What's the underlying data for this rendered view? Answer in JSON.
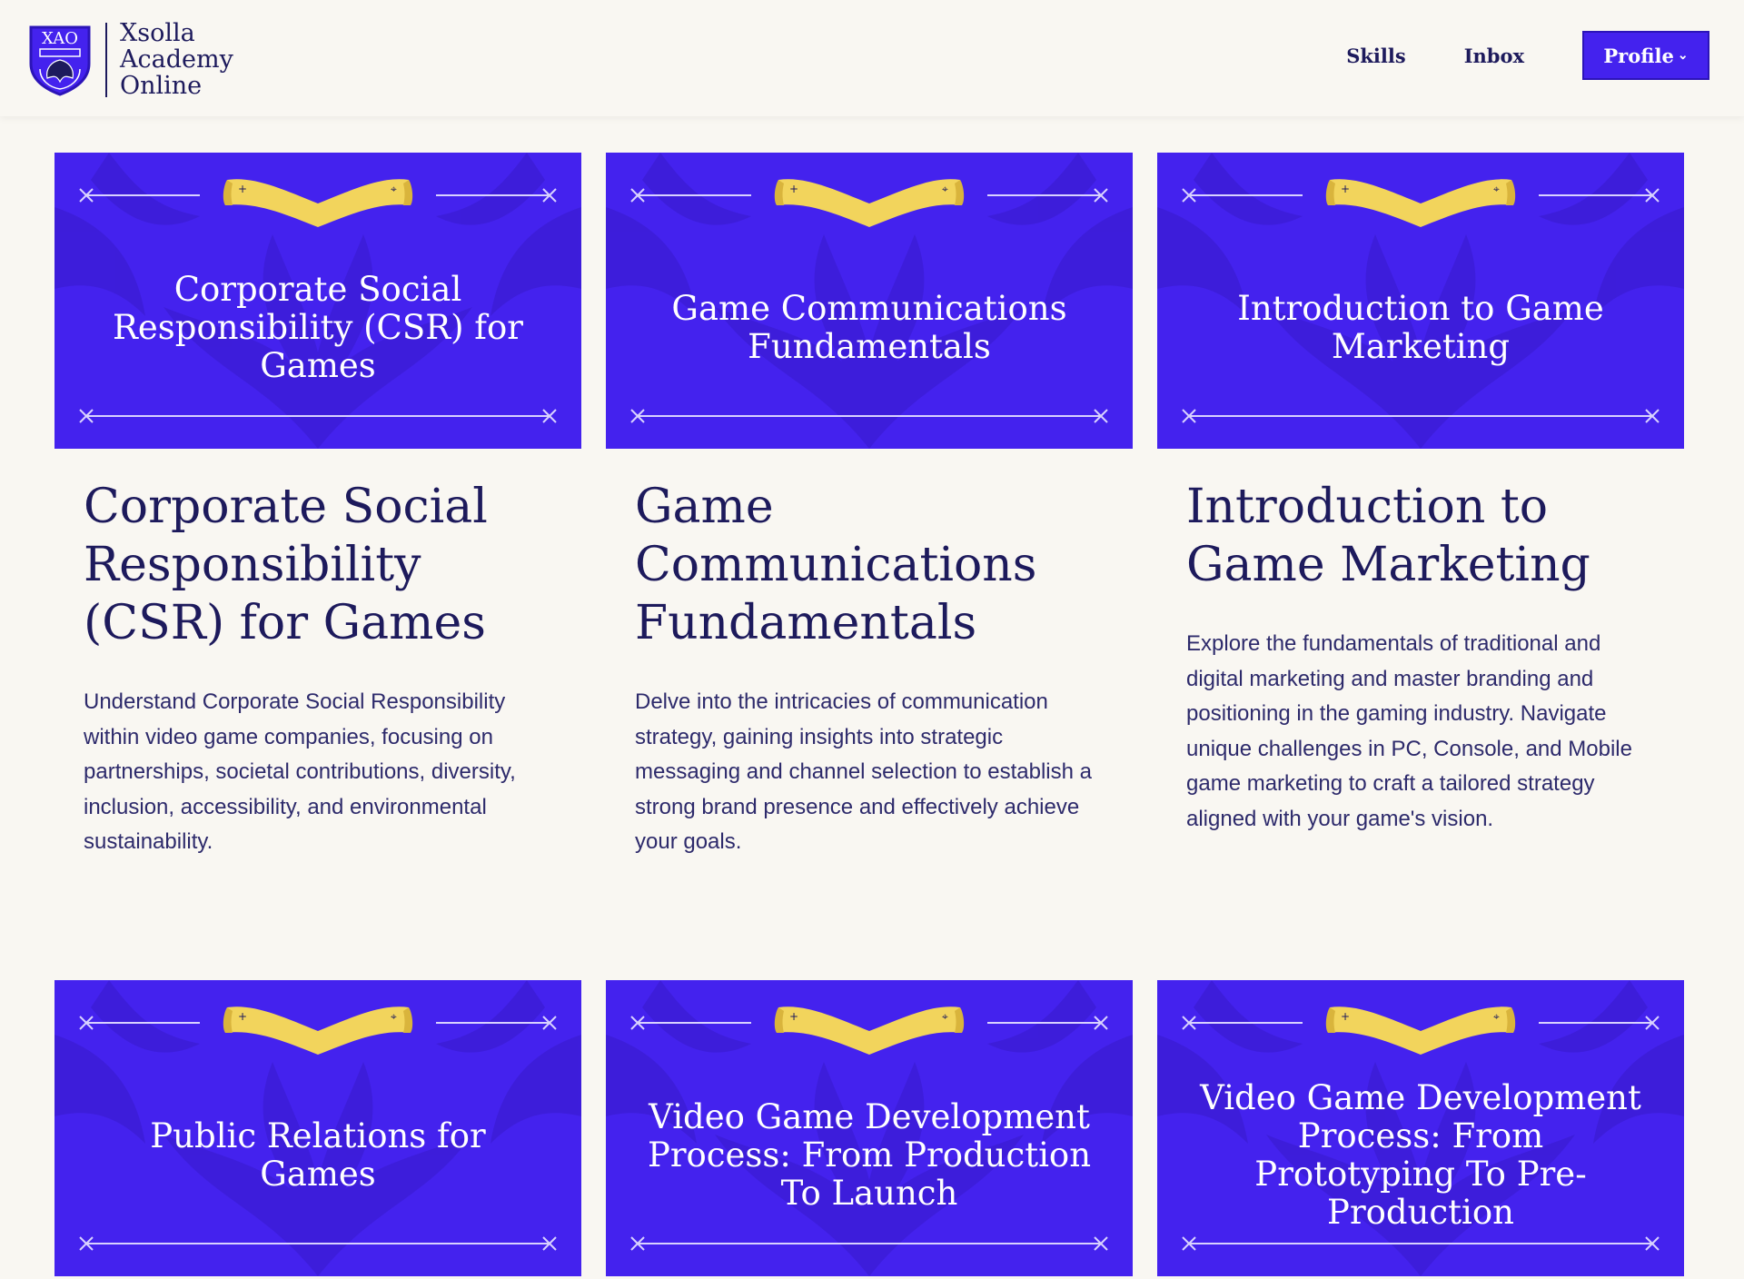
{
  "header": {
    "logo": {
      "crest_text": "XAO",
      "lines": [
        "Xsolla",
        "Academy",
        "Online"
      ]
    },
    "nav": {
      "skills": "Skills",
      "inbox": "Inbox",
      "profile": "Profile"
    }
  },
  "colors": {
    "brand_blue": "#4422ee",
    "banner_yellow": "#f2d45c",
    "ink": "#1d1a5c",
    "page_bg": "#f9f7f2"
  },
  "courses": [
    {
      "thumb_title": "Corporate Social Responsibility (CSR) for Games",
      "title": "Corporate Social Responsibility (CSR) for Games",
      "description": "Understand Corporate Social Responsibility within video game companies, focusing on partnerships, societal contributions, diversity, inclusion, accessibility, and environmental sustainability."
    },
    {
      "thumb_title": "Game Communications Fundamentals",
      "title": "Game Communications Fundamentals",
      "description": "Delve into the intricacies of communication strategy, gaining insights into strategic messaging and channel selection to establish a strong brand presence and effectively achieve your goals."
    },
    {
      "thumb_title": "Introduction to Game Marketing",
      "title": "Introduction to Game Marketing",
      "description": "Explore the fundamentals of traditional and digital marketing and master branding and positioning in the gaming industry. Navigate unique challenges in PC, Console, and Mobile game marketing to craft a tailored strategy aligned with your game's vision."
    },
    {
      "thumb_title": "Public Relations for Games"
    },
    {
      "thumb_title": "Video Game Development Process: From Production To Launch"
    },
    {
      "thumb_title": "Video Game Development Process: From Prototyping To Pre-Production"
    }
  ]
}
